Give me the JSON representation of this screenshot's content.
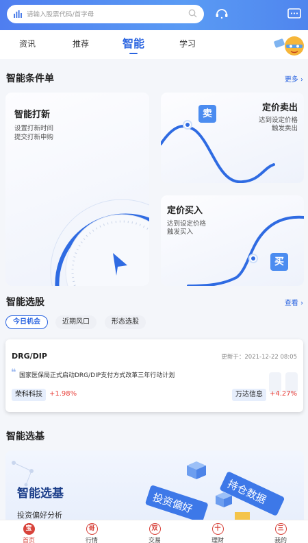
{
  "search": {
    "placeholder": "请输入股票代码/首字母"
  },
  "tabs": [
    {
      "label": "资讯"
    },
    {
      "label": "推荐"
    },
    {
      "label": "智能"
    },
    {
      "label": "学习"
    }
  ],
  "conditions": {
    "title": "智能条件单",
    "more": "更多",
    "ipo": {
      "title": "智能打新",
      "line1": "设置打新时间",
      "line2": "提交打新申购"
    },
    "sell": {
      "title": "定价卖出",
      "line1": "达到设定价格",
      "line2": "触发卖出",
      "badge": "卖"
    },
    "buy": {
      "title": "定价买入",
      "line1": "达到设定价格",
      "line2": "触发买入",
      "badge": "买"
    }
  },
  "picker": {
    "title": "智能选股",
    "more": "查看",
    "pills": [
      "今日机会",
      "近期风口",
      "形态选股"
    ]
  },
  "stock_card": {
    "code": "DRG/DIP",
    "updated": "更新于：2021-12-22 08:05",
    "news": "国家医保局正式启动DRG/DIP支付方式改革三年行动计划",
    "quote_mark": "❝",
    "stocks": [
      {
        "name": "荣科科技",
        "change": "+1.98%"
      },
      {
        "name": "万达信息",
        "change": "+4.27%"
      }
    ]
  },
  "funds": {
    "title": "智能选基",
    "banner_title": "智能选基",
    "banner_sub": "投资偏好分析",
    "cube_text_1": "投资偏好",
    "cube_text_2": "持仓数据"
  },
  "bottom_nav": [
    {
      "label": "首页",
      "glyph": "宝"
    },
    {
      "label": "行情",
      "glyph": "哥"
    },
    {
      "label": "交易",
      "glyph": "双"
    },
    {
      "label": "理财",
      "glyph": "十"
    },
    {
      "label": "我的",
      "glyph": "三"
    }
  ],
  "colors": {
    "accent": "#2a64e0",
    "header": "#4f85ee",
    "up": "#e8403a",
    "nav_active": "#d8443c"
  }
}
